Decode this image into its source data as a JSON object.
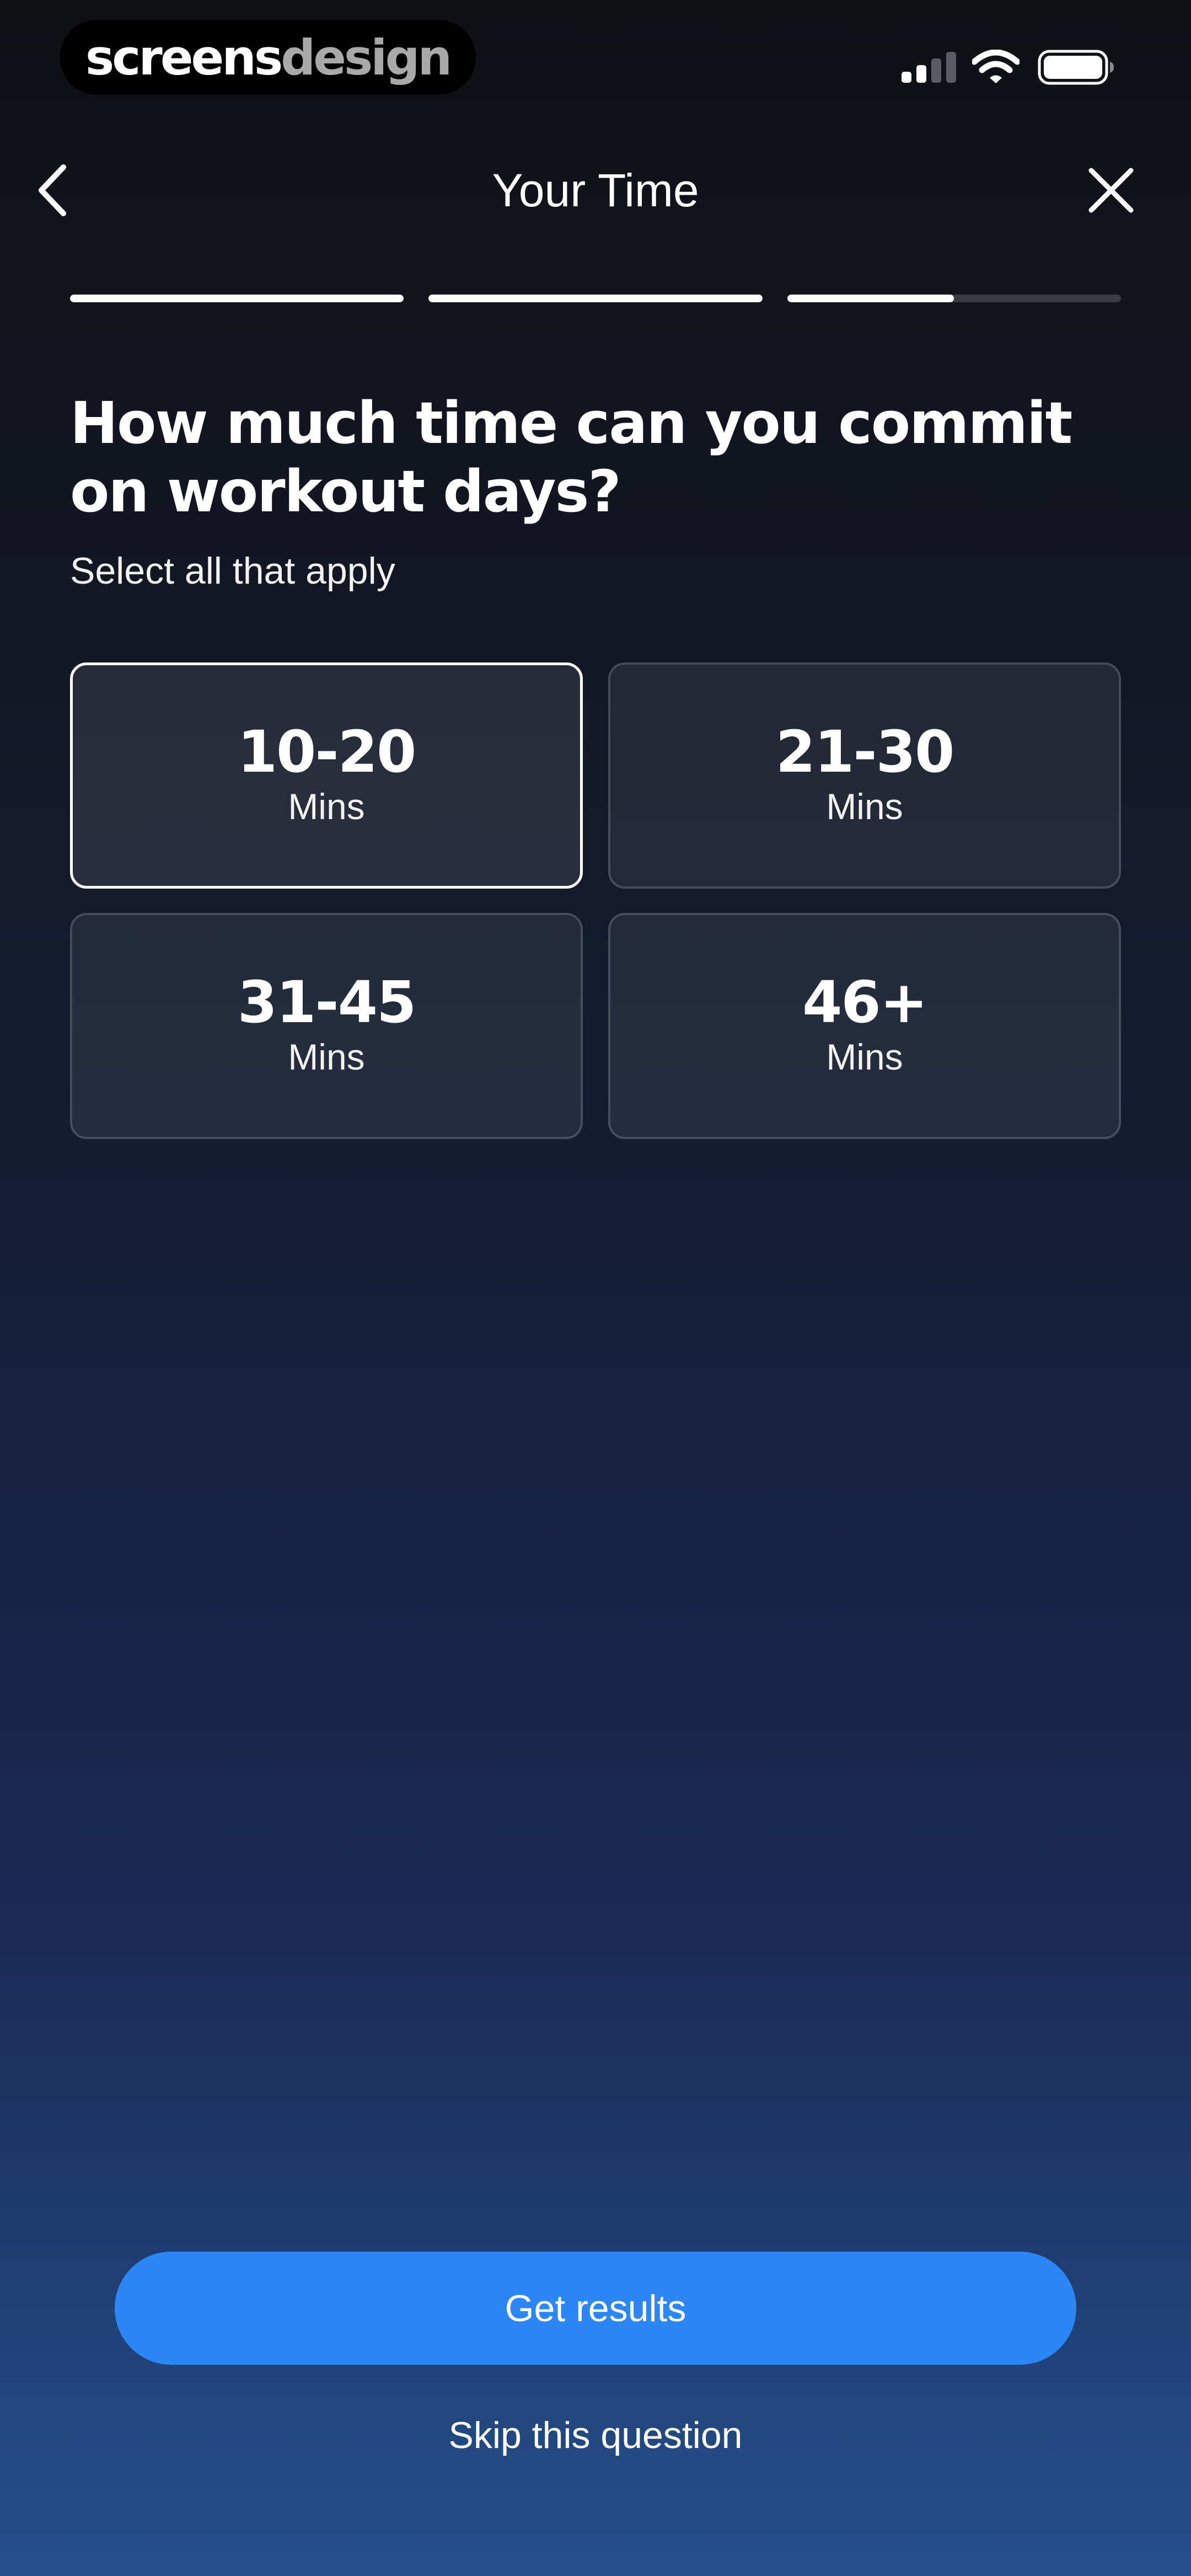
{
  "status_bar": {
    "brand_part1": "screens",
    "brand_part2": "design",
    "signal_icon": "cellular-signal-icon",
    "wifi_icon": "wifi-icon",
    "battery_icon": "battery-icon"
  },
  "header": {
    "title": "Your Time",
    "back_icon": "chevron-left-icon",
    "close_icon": "close-icon"
  },
  "progress": {
    "segments": [
      1.0,
      1.0,
      0.5
    ]
  },
  "question": {
    "title": "How much time can you commit on workout days?",
    "subtitle": "Select all that apply"
  },
  "options": [
    {
      "value": "10-20",
      "unit": "Mins",
      "selected": true
    },
    {
      "value": "21-30",
      "unit": "Mins",
      "selected": false
    },
    {
      "value": "31-45",
      "unit": "Mins",
      "selected": false
    },
    {
      "value": "46+",
      "unit": "Mins",
      "selected": false
    }
  ],
  "actions": {
    "primary_label": "Get results",
    "skip_label": "Skip this question"
  },
  "colors": {
    "accent": "#2d86f5",
    "progress_track": "#3a3c44",
    "progress_fill": "#ffffff"
  }
}
